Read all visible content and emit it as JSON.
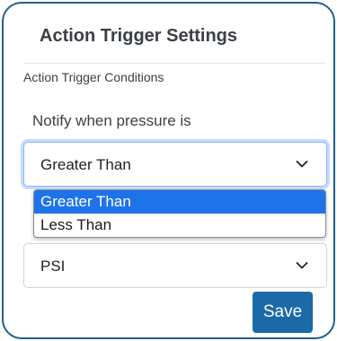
{
  "panel": {
    "title": "Action Trigger Settings",
    "section_label": "Action Trigger Conditions"
  },
  "condition": {
    "label": "Notify when pressure is",
    "selected": "Greater Than",
    "options": [
      "Greater Than",
      "Less Than"
    ],
    "highlighted_option": "Greater Than"
  },
  "unit": {
    "selected": "PSI"
  },
  "actions": {
    "save_label": "Save"
  },
  "colors": {
    "border": "#1e5f8f",
    "accent": "#1a6aa7",
    "option_highlight": "#1e73e8"
  },
  "icons": {
    "dropdown_chevron": "chevron-down-icon"
  }
}
